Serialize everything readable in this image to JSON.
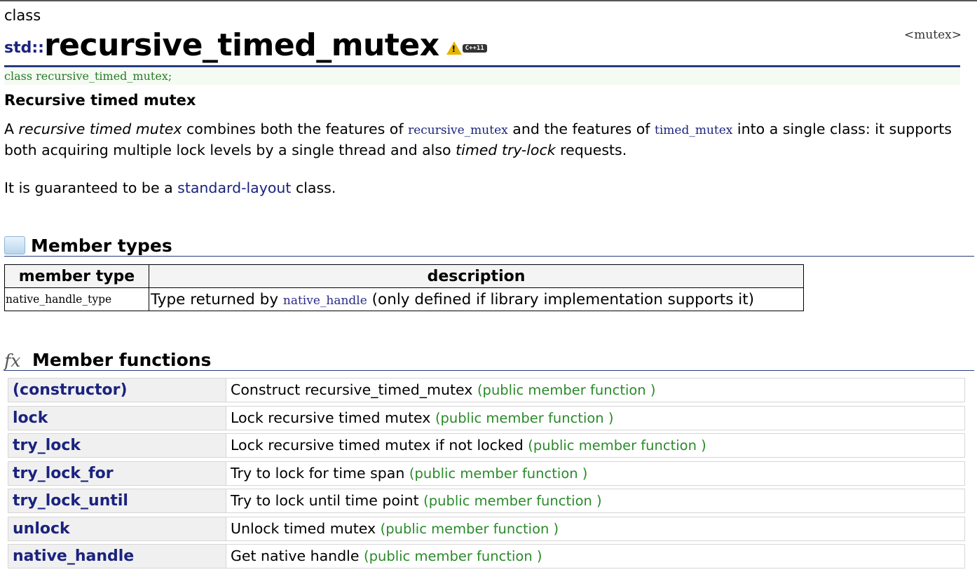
{
  "header": {
    "kind": "class",
    "namespace": "std::",
    "name": "recursive_timed_mutex",
    "badge_symbol": "!",
    "badge_tag": "C++11",
    "header_link": "<mutex>",
    "prototype": "class recursive_timed_mutex;"
  },
  "subtitle": "Recursive timed mutex",
  "para1": {
    "t1": "A ",
    "em1": "recursive timed mutex",
    "t2": " combines both the features of ",
    "code1": "recursive_mutex",
    "t3": " and the features of ",
    "code2": "timed_mutex",
    "t4": " into a single class: it supports both acquiring multiple lock levels by a single thread and also ",
    "em2": "timed try-lock",
    "t5": " requests."
  },
  "para2": {
    "t1": "It is guaranteed to be a ",
    "link": "standard-layout",
    "t2": " class."
  },
  "member_types": {
    "heading": "Member types",
    "col1": "member type",
    "col2": "description",
    "rows": [
      {
        "type": "native_handle_type",
        "d1": "Type returned by ",
        "code": "native_handle",
        "d2": " (only defined if library implementation supports it)"
      }
    ]
  },
  "member_functions": {
    "heading": "Member functions",
    "icon_text": "fx",
    "rows": [
      {
        "name": "(constructor)",
        "desc": "Construct recursive_timed_mutex ",
        "kind": "(public member function )"
      },
      {
        "name": "lock",
        "desc": "Lock recursive timed mutex ",
        "kind": "(public member function )"
      },
      {
        "name": "try_lock",
        "desc": "Lock recursive timed mutex if not locked ",
        "kind": "(public member function )"
      },
      {
        "name": "try_lock_for",
        "desc": "Try to lock for time span ",
        "kind": "(public member function )"
      },
      {
        "name": "try_lock_until",
        "desc": "Try to lock until time point ",
        "kind": "(public member function )"
      },
      {
        "name": "unlock",
        "desc": "Unlock timed mutex ",
        "kind": "(public member function )"
      },
      {
        "name": "native_handle",
        "desc": "Get native handle ",
        "kind": "(public member function )"
      }
    ]
  }
}
